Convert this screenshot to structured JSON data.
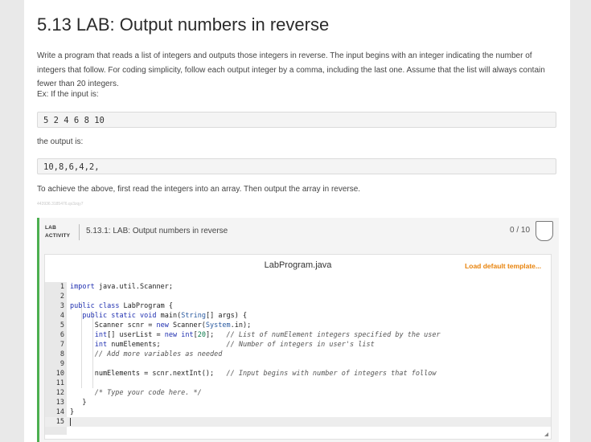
{
  "title": "5.13 LAB: Output numbers in reverse",
  "description": "Write a program that reads a list of integers and outputs those integers in reverse. The input begins with an integer indicating the number of integers that follow. For coding simplicity, follow each output integer by a comma, including the last one. Assume that the list will always contain fewer than 20 integers.",
  "example_input_label": "Ex: If the input is:",
  "example_input": "5 2 4 6 8 10",
  "example_output_label": "the output is:",
  "example_output": "10,8,6,4,2,",
  "achieve_text": "To achieve the above, first read the integers into an array. Then output the array in reverse.",
  "tiny_id": "443936.3185476.qx3zqy7",
  "lab_activity": {
    "tag_line1": "LAB",
    "tag_line2": "ACTIVITY",
    "title": "5.13.1: LAB: Output numbers in reverse",
    "score": "0 / 10"
  },
  "editor": {
    "filename": "LabProgram.java",
    "load_template": "Load default template...",
    "line_numbers": [
      "1",
      "2",
      "3",
      "4",
      "5",
      "6",
      "7",
      "8",
      "9",
      "10",
      "11",
      "12",
      "13",
      "14",
      "15"
    ]
  }
}
